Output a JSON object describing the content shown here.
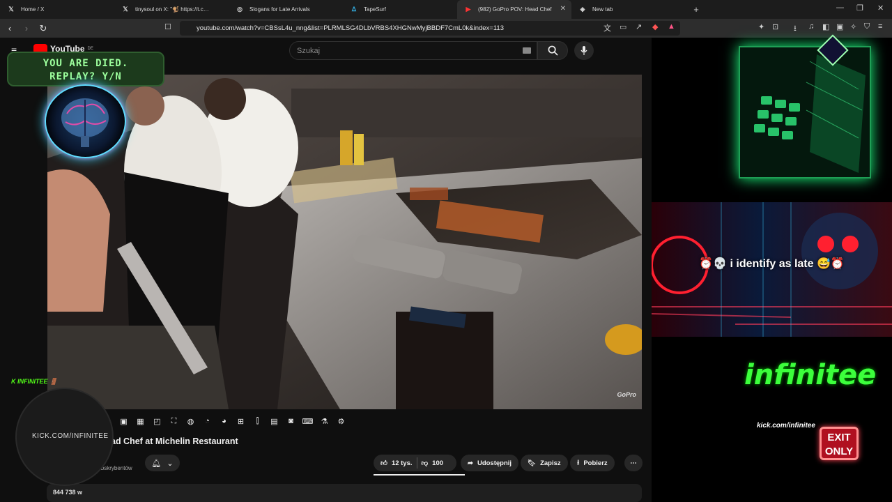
{
  "tabs": [
    {
      "title": "Home / X",
      "icon": "X"
    },
    {
      "title": "tinysoul on X: \"🐒 https://t.co/V4Xq",
      "icon": "X"
    },
    {
      "title": "Slogans for Late Arrivals",
      "icon": "◎"
    },
    {
      "title": "TapeSurf",
      "icon": "ᐃ"
    },
    {
      "title": "(982) GoPro POV: Head Chef",
      "icon": "▶"
    },
    {
      "title": "New tab",
      "icon": "◈"
    }
  ],
  "address": {
    "url": "youtube.com/watch?v=CBSsL4u_nng&list=PLRMLSG4DLbVRBS4XHGNwMyjBBDF7CmL0k&index=113"
  },
  "youtube": {
    "logo": "YouTube",
    "region": "DE",
    "search_placeholder": "Szukaj",
    "video_watermark": "GoPro",
    "title": "GoPro POV: Head Chef at Michelin Restaurant",
    "subscribers": "11,5 mln subskrybentów",
    "likes": "12 tys.",
    "dislikes": "100",
    "share": "Udostępnij",
    "save": "Zapisz",
    "download": "Pobierz",
    "views": "844 738 w"
  },
  "overlay": {
    "game_over_line1": "YOU ARE DIED.",
    "game_over_line2": "REPLAY? Y/N",
    "kick_url": "KICK.COM/INFINITEE",
    "kick_top": "INFINITEE",
    "banner_text": "⏰💀 i identify as late 😅⏰",
    "logo_text": "infinitee",
    "logo_url": "kick.com/infinitee",
    "exit_line1": "EXIT",
    "exit_line2": "ONLY"
  },
  "colors": {
    "accent_green": "#3cff3c",
    "youtube_red": "#ff0000",
    "exit_red": "#b01020"
  }
}
